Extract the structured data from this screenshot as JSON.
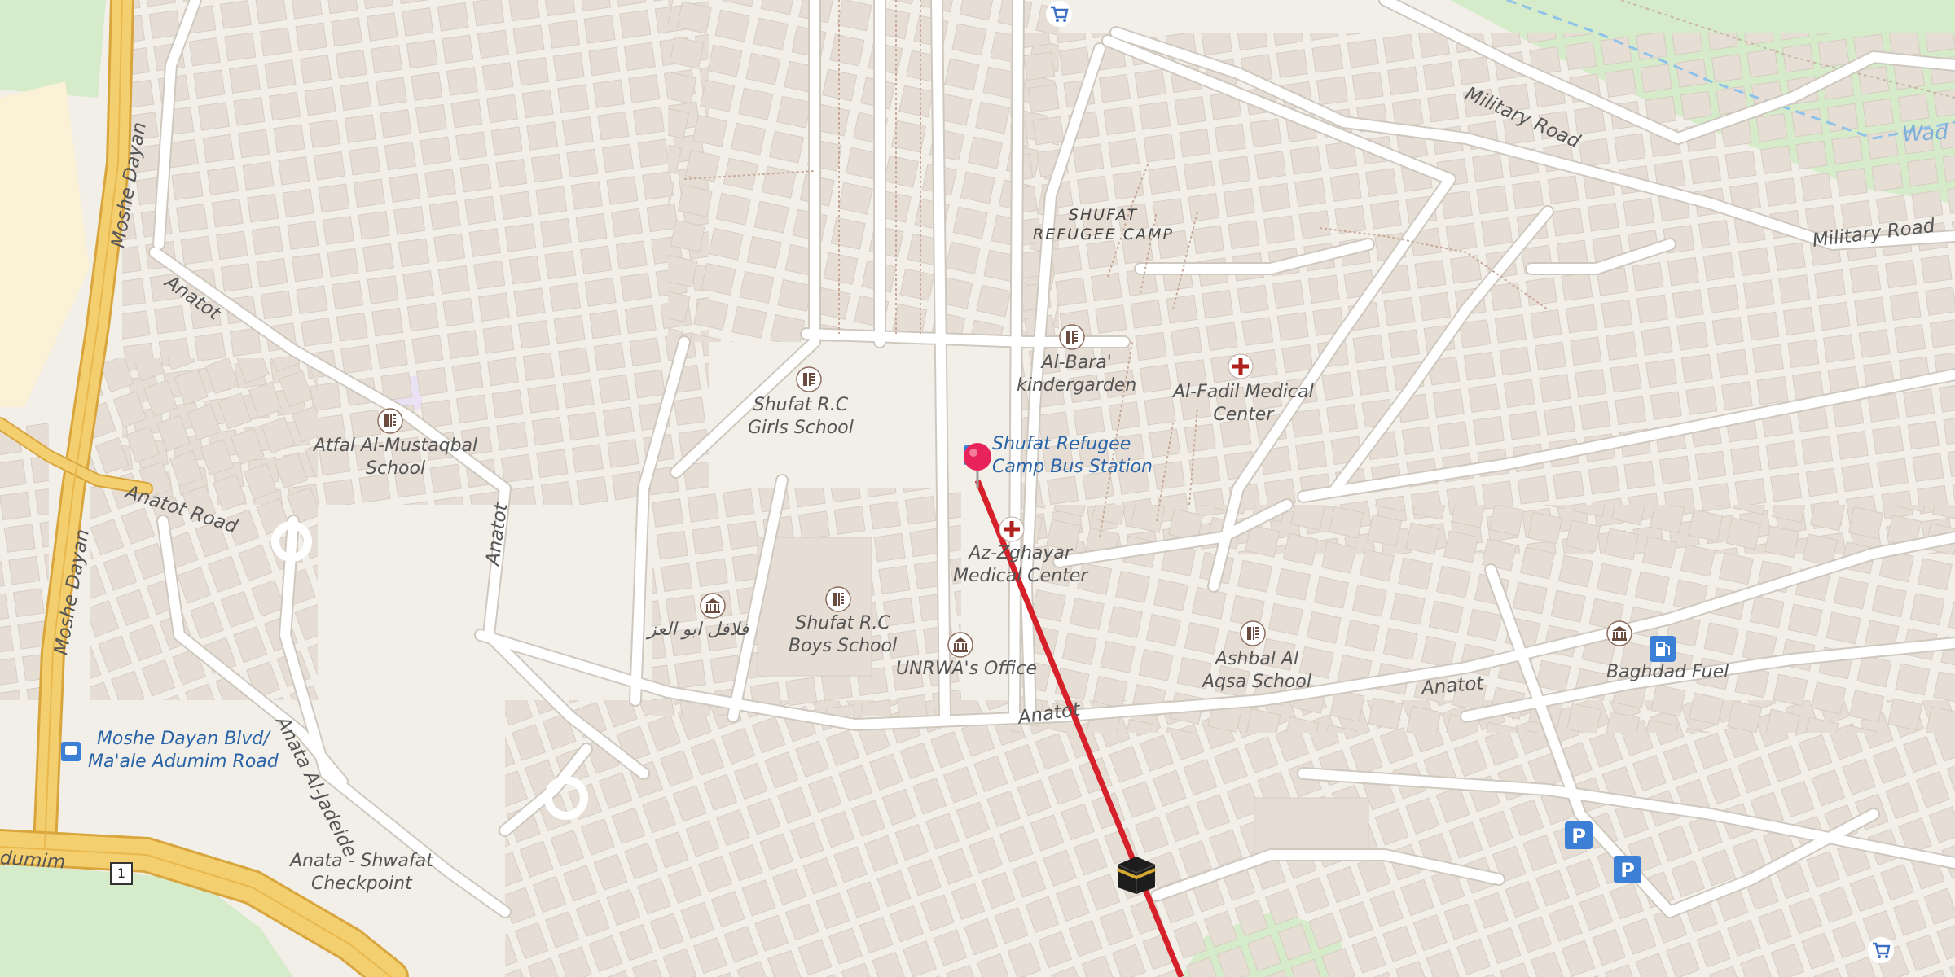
{
  "map": {
    "area_label": "SHUFAT\nREFUGEE CAMP",
    "roads": [
      {
        "key": "military1",
        "name": "Military Road"
      },
      {
        "key": "military2",
        "name": "Military Road"
      },
      {
        "key": "moshe1",
        "name": "Moshe Dayan"
      },
      {
        "key": "moshe2",
        "name": "Moshe Dayan"
      },
      {
        "key": "anatot1",
        "name": "Anatot"
      },
      {
        "key": "anatotroad",
        "name": "Anatot Road"
      },
      {
        "key": "anatot2",
        "name": "Anatot"
      },
      {
        "key": "anatot3",
        "name": "Anatot"
      },
      {
        "key": "anatot4",
        "name": "Anatot"
      },
      {
        "key": "jadeide",
        "name": "Anata Al-Jadeide"
      },
      {
        "key": "adumim",
        "name": "dumim"
      },
      {
        "key": "wadi",
        "name": "Wad"
      },
      {
        "key": "route",
        "name": "1"
      }
    ],
    "pois": [
      {
        "key": "shufat_girls",
        "name": "Shufat R.C\nGirls School",
        "icon": "school-icon"
      },
      {
        "key": "albara",
        "name": "Al-Bara'\nkindergarden",
        "icon": "school-icon"
      },
      {
        "key": "alfadil",
        "name": "Al-Fadil Medical\nCenter",
        "icon": "medical-cross-icon"
      },
      {
        "key": "atfal",
        "name": "Atfal Al-Mustaqbal\nSchool",
        "icon": "school-icon"
      },
      {
        "key": "busstation",
        "name": "Shufat Refugee\nCamp Bus Station",
        "icon": "bus-stop-icon"
      },
      {
        "key": "azzghayar",
        "name": "Az-Zghayar\nMedical Center",
        "icon": "medical-cross-icon"
      },
      {
        "key": "arabic",
        "name": "فلافل ابو العز",
        "icon": "museum-icon"
      },
      {
        "key": "shufat_boys",
        "name": "Shufat R.C\nBoys School",
        "icon": "school-icon"
      },
      {
        "key": "unrwa",
        "name": "UNRWA's Office",
        "icon": "museum-icon"
      },
      {
        "key": "ashbal",
        "name": "Ashbal Al\nAqsa School",
        "icon": "school-icon"
      },
      {
        "key": "baghdad",
        "name": "Baghdad Fuel",
        "icon": "fuel-icon"
      },
      {
        "key": "mosheblvd",
        "name": "Moshe Dayan Blvd/\nMa'ale Adumim Road",
        "icon": "bus-stop-icon"
      },
      {
        "key": "checkpoint",
        "name": "Anata - Shwafat\nCheckpoint",
        "icon": ""
      }
    ],
    "markers": {
      "pin": "location-pin-icon",
      "kaaba": "kaaba-icon",
      "route_line_color": "#d6202a",
      "pin_color": "#e8235a"
    },
    "colors": {
      "background": "#f2efe9",
      "building": "#e6ded5",
      "road": "#ffffff",
      "highway": "#f4cf6f",
      "park": "#d5ebc9"
    }
  }
}
